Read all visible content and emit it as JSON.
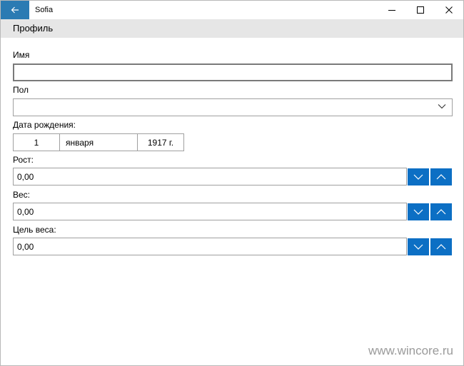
{
  "titlebar": {
    "title": "Sofia",
    "back_icon": "arrow-left-icon",
    "minimize_icon": "minimize-icon",
    "maximize_icon": "maximize-icon",
    "close_icon": "close-icon"
  },
  "header": {
    "title": "Профиль"
  },
  "form": {
    "name_label": "Имя",
    "name_value": "",
    "gender_label": "Пол",
    "gender_value": "",
    "birth_label": "Дата рождения:",
    "birth_day": "1",
    "birth_month": "января",
    "birth_year": "1917 г.",
    "height_label": "Рост:",
    "height_value": "0,00",
    "weight_label": "Вес:",
    "weight_value": "0,00",
    "goal_label": "Цель веса:",
    "goal_value": "0,00"
  },
  "colors": {
    "accent": "#0c6fc4",
    "back_button": "#2b7bb3",
    "header_bg": "#e6e6e6"
  },
  "watermark": "www.wincore.ru"
}
